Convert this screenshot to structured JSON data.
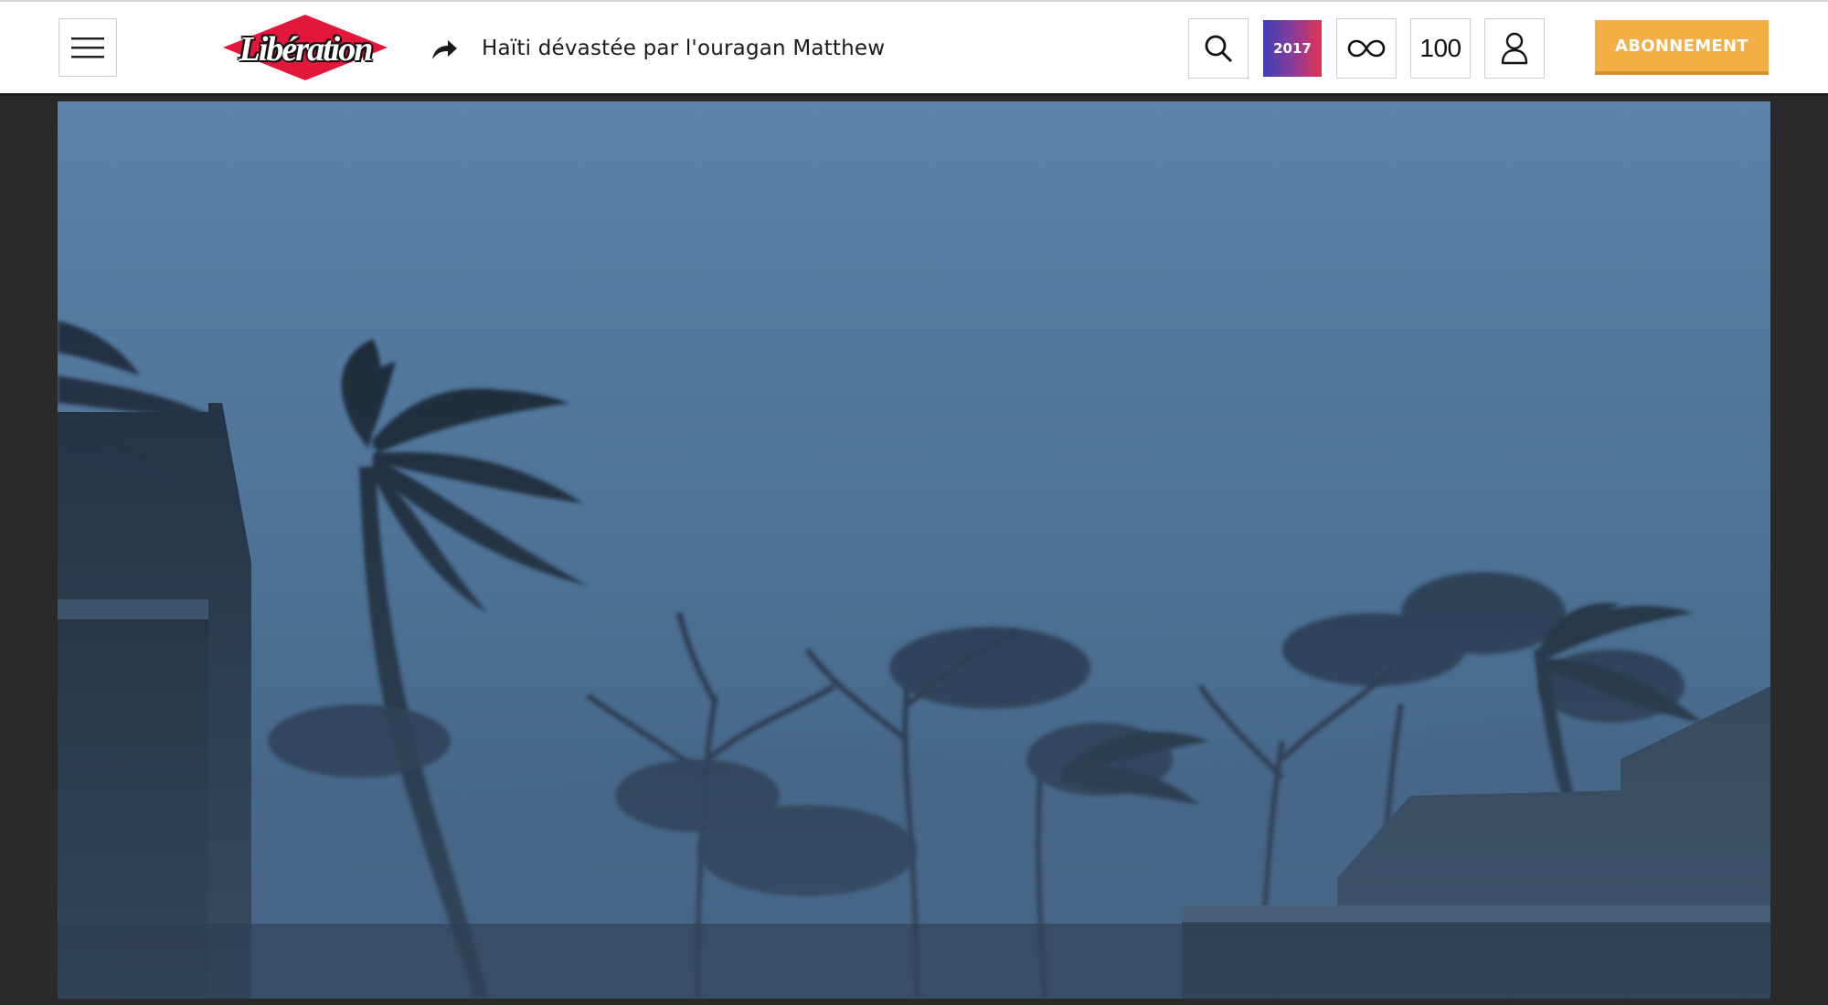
{
  "header": {
    "menu_icon": "hamburger-menu-icon",
    "logo_text": "Libération",
    "headline_icon": "share-arrow-icon",
    "headline": "Haïti dévastée par l'ouragan Matthew",
    "search_icon": "search-icon",
    "badge_2017": "2017",
    "infinity_icon": "infinity-icon",
    "hundred_label": "100",
    "account_icon": "user-icon",
    "subscribe_label": "ABONNEMENT"
  },
  "colors": {
    "subscribe": "#f3ae45",
    "logo_red": "#e2173b",
    "sky_top": "#5b82ab",
    "sky_bottom": "#2e4a66"
  }
}
